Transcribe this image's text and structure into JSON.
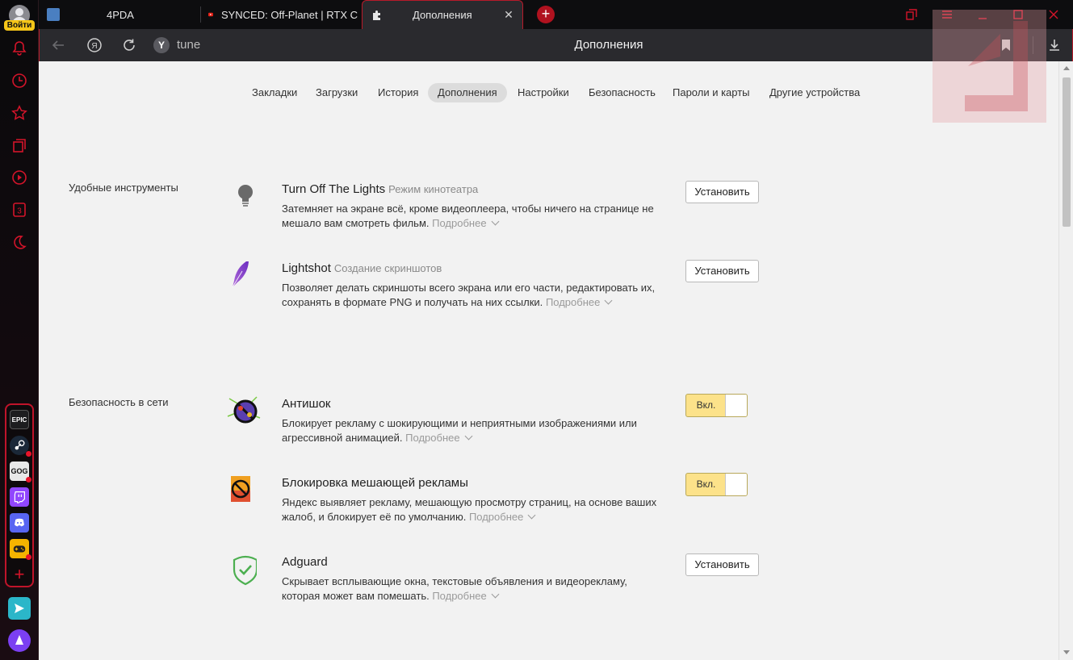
{
  "sidebar": {
    "login_label": "Войти",
    "icons": [
      "bell-icon",
      "clock-icon",
      "star-icon",
      "collections-icon",
      "play-icon",
      "number-3-icon",
      "moon-icon"
    ],
    "games": [
      {
        "name": "epic-games-icon",
        "text": "EPIC",
        "bg": "#222"
      },
      {
        "name": "steam-icon",
        "text": "",
        "bg": "#1b2838"
      },
      {
        "name": "gog-icon",
        "text": "GOG",
        "bg": "#e0e0e0"
      },
      {
        "name": "twitch-icon",
        "text": "",
        "bg": "#9146ff"
      },
      {
        "name": "discord-icon",
        "text": "",
        "bg": "#5865f2"
      },
      {
        "name": "gamepad-icon",
        "text": "",
        "bg": "#f5b400"
      }
    ]
  },
  "tabs": [
    {
      "label": "4PDA",
      "active": false
    },
    {
      "label": "SYNCED: Off-Planet | RTX C",
      "active": false
    },
    {
      "label": "Дополнения",
      "active": true
    }
  ],
  "address": {
    "omni_letter": "Y",
    "omni_text": "tune",
    "page_title": "Дополнения",
    "back_letter": "Я"
  },
  "nav_tabs": [
    {
      "label": "Закладки",
      "active": false
    },
    {
      "label": "Загрузки",
      "active": false
    },
    {
      "label": "История",
      "active": false
    },
    {
      "label": "Дополнения",
      "active": true
    },
    {
      "label": "Настройки",
      "active": false
    },
    {
      "label": "Безопасность",
      "active": false
    },
    {
      "label": "Пароли и карты",
      "active": false
    },
    {
      "label": "Другие устройства",
      "active": false
    }
  ],
  "sections": {
    "tools": "Удобные инструменты",
    "security": "Безопасность в сети"
  },
  "more_label": "Подробнее",
  "install_label": "Установить",
  "toggle_on_label": "Вкл.",
  "extensions": [
    {
      "title": "Turn Off The Lights",
      "subtitle": "Режим кинотеатра",
      "line1": "Затемняет на экране всё, кроме видеоплеера, чтобы ничего на странице не",
      "line2": "мешало вам смотреть фильм.",
      "state": "install"
    },
    {
      "title": "Lightshot",
      "subtitle": "Создание скриншотов",
      "line1": "Позволяет делать скриншоты всего экрана или его части, редактировать их,",
      "line2": "сохранять в формате PNG и получать на них ссылки.",
      "state": "install"
    },
    {
      "title": "Антишок",
      "subtitle": "",
      "line1": "Блокирует рекламу с шокирующими и неприятными изображениями или",
      "line2": "агрессивной анимацией.",
      "state": "on"
    },
    {
      "title": "Блокировка мешающей рекламы",
      "subtitle": "",
      "line1": "Яндекс выявляет рекламу, мешающую просмотру страниц, на основе ваших",
      "line2": "жалоб, и блокирует её по умолчанию.",
      "state": "on"
    },
    {
      "title": "Adguard",
      "subtitle": "",
      "line1": "Скрывает всплывающие окна, текстовые объявления и видеорекламу,",
      "line2": "которая может вам помешать.",
      "state": "install"
    }
  ],
  "colors": {
    "accent": "#d4142a",
    "toggle_on": "#fce28a",
    "content_bg": "#f2f2f2"
  }
}
